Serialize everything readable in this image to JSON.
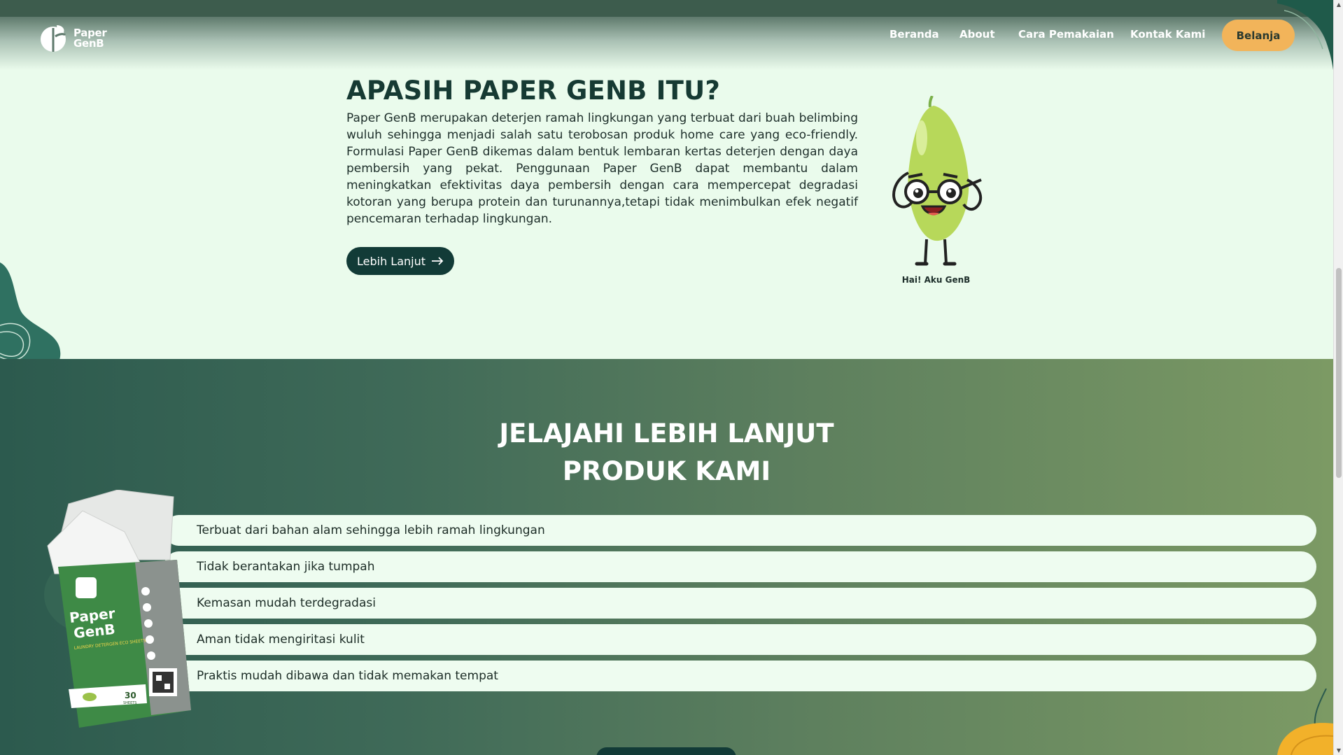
{
  "header": {
    "logo_line1": "Paper",
    "logo_line2": "GenB",
    "nav": [
      "Beranda",
      "About",
      "Cara Pemakaian",
      "Kontak Kami"
    ],
    "cta": "Belanja"
  },
  "about": {
    "title": "APASIH PAPER GENB ITU?",
    "body": "Paper GenB merupakan deterjen ramah lingkungan yang terbuat dari buah belimbing wuluh sehingga menjadi salah satu terobosan produk home care yang eco-friendly. Formulasi Paper GenB dikemas dalam bentuk lembaran kertas deterjen dengan daya pembersih yang pekat. Penggunaan Paper GenB dapat membantu dalam meningkatkan efektivitas daya pembersih dengan cara mempercepat degradasi kotoran yang berupa protein dan turunannya,tetapi tidak menimbulkan efek negatif pencemaran terhadap lingkungan.",
    "button": "Lebih Lanjut",
    "mascot_caption": "Hai! Aku GenB"
  },
  "explore": {
    "title_line1": "JELAJAHI LEBIH LANJUT",
    "title_line2": "PRODUK KAMI",
    "features": [
      "Terbuat dari bahan alam sehingga lebih ramah lingkungan",
      "Tidak berantakan jika tumpah",
      "Kemasan mudah terdegradasi",
      "Aman tidak mengiritasi kulit",
      "Praktis mudah dibawa dan tidak memakan tempat"
    ]
  },
  "product_pack": {
    "brand_line1": "Paper",
    "brand_line2": "GenB",
    "subtitle": "LAUNDRY DETERGEN ECO SHEETS",
    "count": "30",
    "count_label": "SHEETS"
  },
  "colors": {
    "accent": "#f2b45a",
    "dark": "#123b37",
    "bg": "#eafbec",
    "section": "#3f6a58"
  },
  "icons": {
    "arrow": "arrow-right-icon",
    "logo": "leaf-logo-icon"
  }
}
